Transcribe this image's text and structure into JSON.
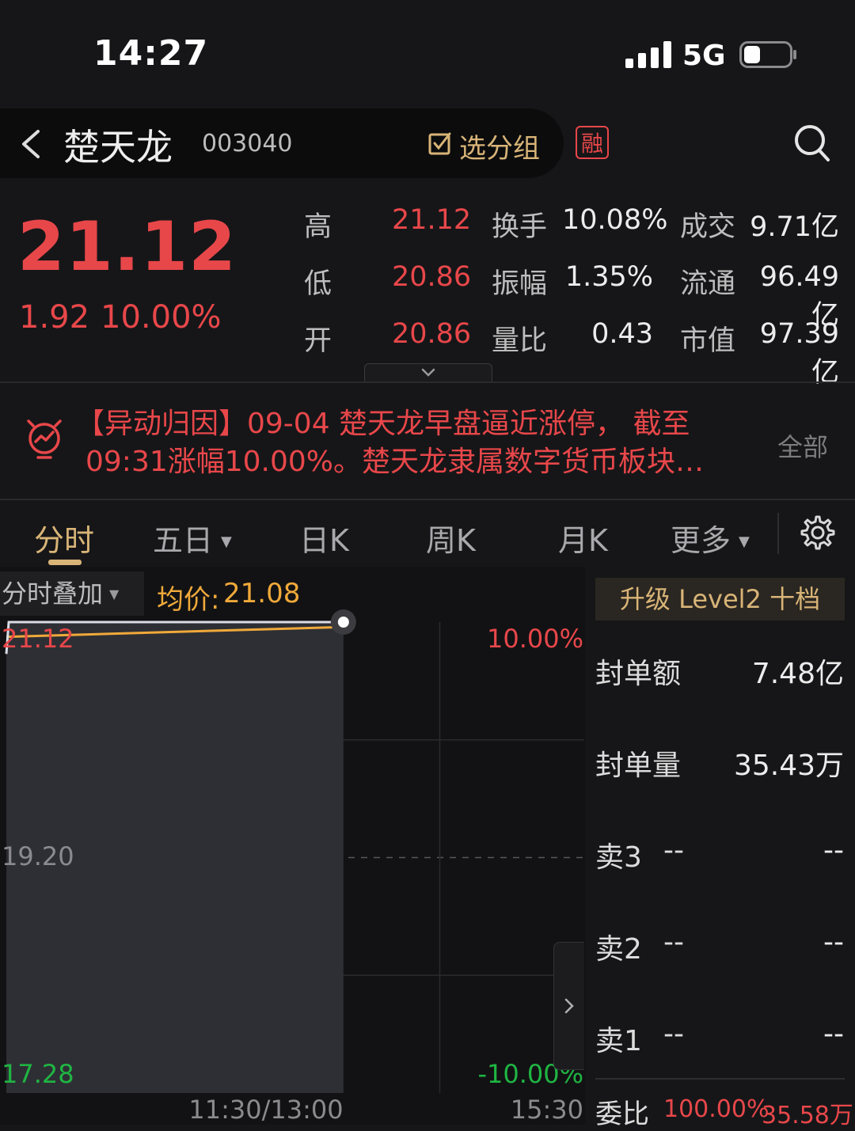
{
  "status_bar": {
    "time": "14:27",
    "network": "5G"
  },
  "header": {
    "back_icon": "chevron-left-icon",
    "name": "楚天龙",
    "code": "003040",
    "group_label": "选分组",
    "margin_badge": "融",
    "search_icon": "search-icon"
  },
  "quote": {
    "price": "21.12",
    "change": "1.92",
    "change_pct": "10.00%",
    "stats": [
      [
        {
          "label": "高",
          "value": "21.12"
        },
        {
          "label": "换手",
          "value": "10.08%"
        },
        {
          "label": "成交",
          "value": "9.71亿"
        }
      ],
      [
        {
          "label": "低",
          "value": "20.86"
        },
        {
          "label": "振幅",
          "value": "1.35%"
        },
        {
          "label": "流通",
          "value": "96.49亿"
        }
      ],
      [
        {
          "label": "开",
          "value": "20.86"
        },
        {
          "label": "量比",
          "value": "0.43"
        },
        {
          "label": "市值",
          "value": "97.39亿"
        }
      ]
    ]
  },
  "news": {
    "line1": "【异动归因】09-04 楚天龙早盘逼近涨停， 截至",
    "line2": "09:31涨幅10.00%。楚天龙隶属数字货币板块…",
    "all_label": "全部"
  },
  "tabs": {
    "fenshi": "分时",
    "wuri": "五日",
    "rik": "日K",
    "zhouk": "周K",
    "yuek": "月K",
    "more": "更多"
  },
  "chart": {
    "overlay_label": "分时叠加",
    "avg_label": "均价:",
    "avg_value": "21.08"
  },
  "chart_data": {
    "type": "line",
    "y_labels": {
      "top": "21.12",
      "mid": "19.20",
      "bottom": "17.28"
    },
    "pct_labels": {
      "top": "10.00%",
      "bottom": "-10.00%"
    },
    "x_labels": {
      "mid": "11:30/13:00",
      "end": "15:30"
    },
    "ylim": [
      17.28,
      21.12
    ],
    "pre_close": 19.2,
    "session_minutes": 240,
    "series": [
      {
        "x": [
          0,
          1,
          2,
          140
        ],
        "values": [
          20.86,
          21.12,
          21.12,
          21.12
        ]
      },
      {
        "x": [
          0,
          140
        ],
        "values": [
          21.0,
          21.08
        ]
      }
    ],
    "colors": {
      "price": "#d9dce6",
      "avg": "#f0a93a",
      "fill": "#2e2f34"
    }
  },
  "right_panel": {
    "upgrade_label": "升级 Level2 十档",
    "seal_amount_label": "封单额",
    "seal_amount": "7.48亿",
    "seal_volume_label": "封单量",
    "seal_volume": "35.43万",
    "asks": [
      {
        "label": "卖3",
        "price": "--",
        "volume": "--"
      },
      {
        "label": "卖2",
        "price": "--",
        "volume": "--"
      },
      {
        "label": "卖1",
        "price": "--",
        "volume": "--"
      }
    ],
    "ratio_label": "委比",
    "ratio_pct": "100.00%",
    "ratio_vol": "35.58万"
  }
}
